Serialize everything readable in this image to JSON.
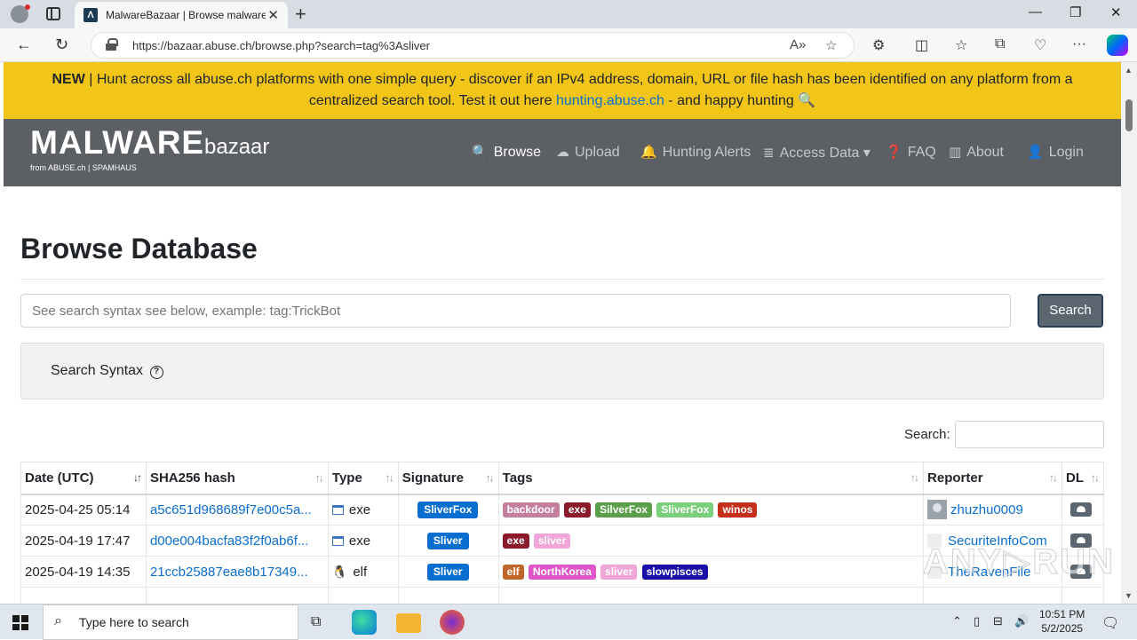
{
  "browser": {
    "tab_title": "MalwareBazaar | Browse malware",
    "url": "https://bazaar.abuse.ch/browse.php?search=tag%3Asliver"
  },
  "banner": {
    "prefix": "NEW",
    "text1": " | Hunt across all abuse.ch platforms with one simple query - discover if an IPv4 address, domain, URL or file hash has been identified on any platform from a centralized search tool. Test it out here ",
    "link": "hunting.abuse.ch",
    "text2": " - and happy hunting 🔍"
  },
  "logo": {
    "main": "MALWARE",
    "sub": "bazaar",
    "small": "from ABUSE.ch | SPAMHAUS"
  },
  "nav": [
    {
      "label": "Browse",
      "icon": "search-icon"
    },
    {
      "label": "Upload",
      "icon": "cloud-upload-icon"
    },
    {
      "label": "Hunting Alerts",
      "icon": "bell-icon"
    },
    {
      "label": "Access Data",
      "icon": "database-icon"
    },
    {
      "label": "FAQ",
      "icon": "question-icon"
    },
    {
      "label": "About",
      "icon": "building-icon"
    },
    {
      "label": "Login",
      "icon": "user-icon"
    }
  ],
  "page": {
    "title": "Browse Database",
    "search_placeholder": "See search syntax see below, example: tag:TrickBot",
    "search_button": "Search",
    "syntax_label": "Search Syntax",
    "table_search_label": "Search:"
  },
  "table": {
    "headers": [
      "Date (UTC)",
      "SHA256 hash",
      "Type",
      "Signature",
      "Tags",
      "Reporter",
      "DL"
    ],
    "rows": [
      {
        "date": "2025-04-25 05:14",
        "hash": "a5c651d968689f7e00c5a...",
        "type": "exe",
        "signature": "SliverFox",
        "tags": [
          {
            "t": "backdoor",
            "c": "#c57f9e"
          },
          {
            "t": "exe",
            "c": "#8b1a2b"
          },
          {
            "t": "SilverFox",
            "c": "#5aa04a"
          },
          {
            "t": "SliverFox",
            "c": "#7ad07a"
          },
          {
            "t": "winos",
            "c": "#c4301c"
          }
        ],
        "reporter": "zhuzhu0009"
      },
      {
        "date": "2025-04-19 17:47",
        "hash": "d00e004bacfa83f2f0ab6f...",
        "type": "exe",
        "signature": "Sliver",
        "tags": [
          {
            "t": "exe",
            "c": "#8b1a2b"
          },
          {
            "t": "sliver",
            "c": "#f0a6d8"
          }
        ],
        "reporter": "SecuriteInfoCom"
      },
      {
        "date": "2025-04-19 14:35",
        "hash": "21ccb25887eae8b17349...",
        "type": "elf",
        "signature": "Sliver",
        "tags": [
          {
            "t": "elf",
            "c": "#c0662a"
          },
          {
            "t": "NorthKorea",
            "c": "#e055c9"
          },
          {
            "t": "sliver",
            "c": "#f0a6d8"
          },
          {
            "t": "slowpisces",
            "c": "#1a10a8"
          }
        ],
        "reporter": "TheRavenFile"
      }
    ]
  },
  "taskbar": {
    "search_placeholder": "Type here to search",
    "time": "10:51 PM",
    "date": "5/2/2025"
  }
}
